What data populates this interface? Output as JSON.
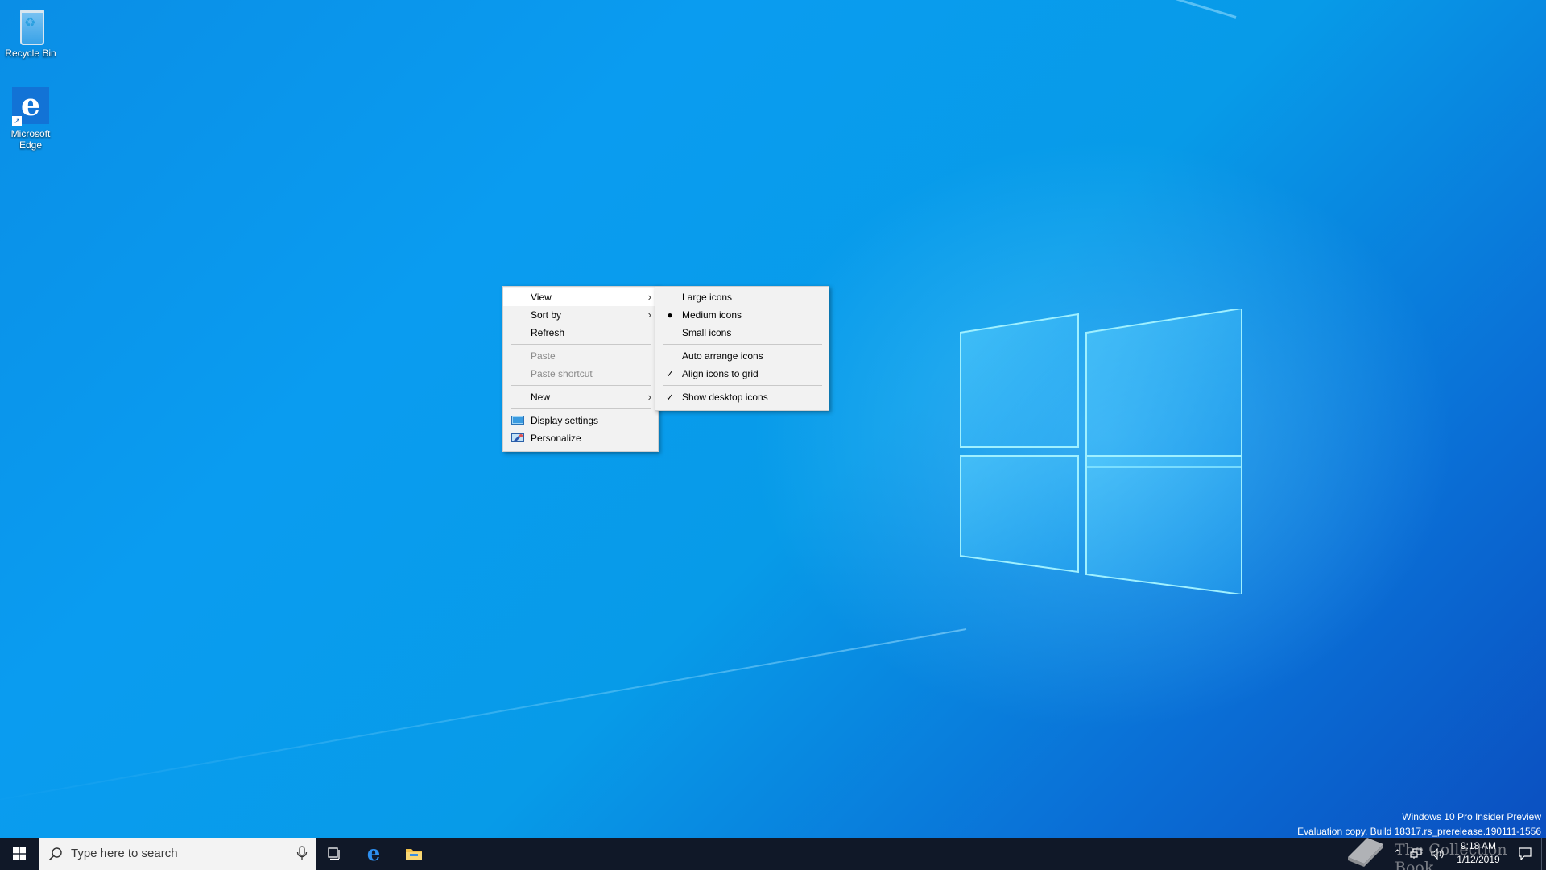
{
  "desktop": {
    "icons": [
      {
        "label": "Recycle Bin",
        "icon": "recycle-bin-icon"
      },
      {
        "label": "Microsoft Edge",
        "icon": "edge-icon"
      }
    ]
  },
  "context_menu": {
    "items": [
      {
        "label": "View",
        "submenu": true,
        "state": "hover"
      },
      {
        "label": "Sort by",
        "submenu": true
      },
      {
        "label": "Refresh"
      },
      {
        "label": "Paste",
        "disabled": true
      },
      {
        "label": "Paste shortcut",
        "disabled": true
      },
      {
        "label": "New",
        "submenu": true
      },
      {
        "label": "Display settings",
        "icon": "display-settings-icon"
      },
      {
        "label": "Personalize",
        "icon": "personalize-icon"
      }
    ]
  },
  "view_submenu": {
    "items": [
      {
        "label": "Large icons"
      },
      {
        "label": "Medium icons",
        "mark": "bullet"
      },
      {
        "label": "Small icons"
      },
      {
        "label": "Auto arrange icons"
      },
      {
        "label": "Align icons to grid",
        "mark": "check"
      },
      {
        "label": "Show desktop icons",
        "mark": "check"
      }
    ]
  },
  "watermark": {
    "line1": "Windows 10 Pro Insider Preview",
    "line2": "Evaluation copy. Build 18317.rs_prerelease.190111-1556"
  },
  "taskbar": {
    "search_placeholder": "Type here to search",
    "pinned": [
      "task-view-icon",
      "edge-icon",
      "file-explorer-icon"
    ],
    "clock_time": "9:18 AM",
    "clock_date": "1/12/2019"
  },
  "overlay": {
    "logo_text": "The Collection Book"
  },
  "colors": {
    "wallpaper": "#0a8ee6",
    "taskbar": "#101828",
    "menu_bg": "#f2f2f2"
  }
}
